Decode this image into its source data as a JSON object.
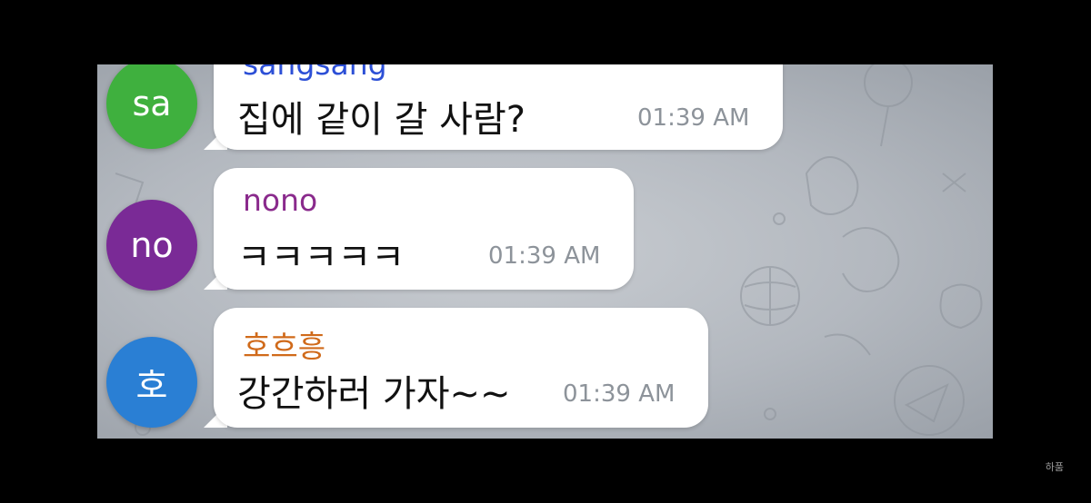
{
  "messages": [
    {
      "sender": "sangsang",
      "sender_color": "#2c4fd6",
      "avatar_text": "sa",
      "avatar_color": "#3fb03e",
      "text": "집에 같이 갈 사람?",
      "time": "01:39 AM"
    },
    {
      "sender": "nono",
      "sender_color": "#8a2a8c",
      "avatar_text": "no",
      "avatar_color": "#7a2a96",
      "text": "ㅋㅋㅋㅋㅋ",
      "time": "01:39 AM"
    },
    {
      "sender": "호흐흥",
      "sender_color": "#d06a1a",
      "avatar_text": "호",
      "avatar_color": "#2a7fd4",
      "text": "강간하러 가자~~",
      "time": "01:39 AM"
    }
  ],
  "watermark": "하품"
}
